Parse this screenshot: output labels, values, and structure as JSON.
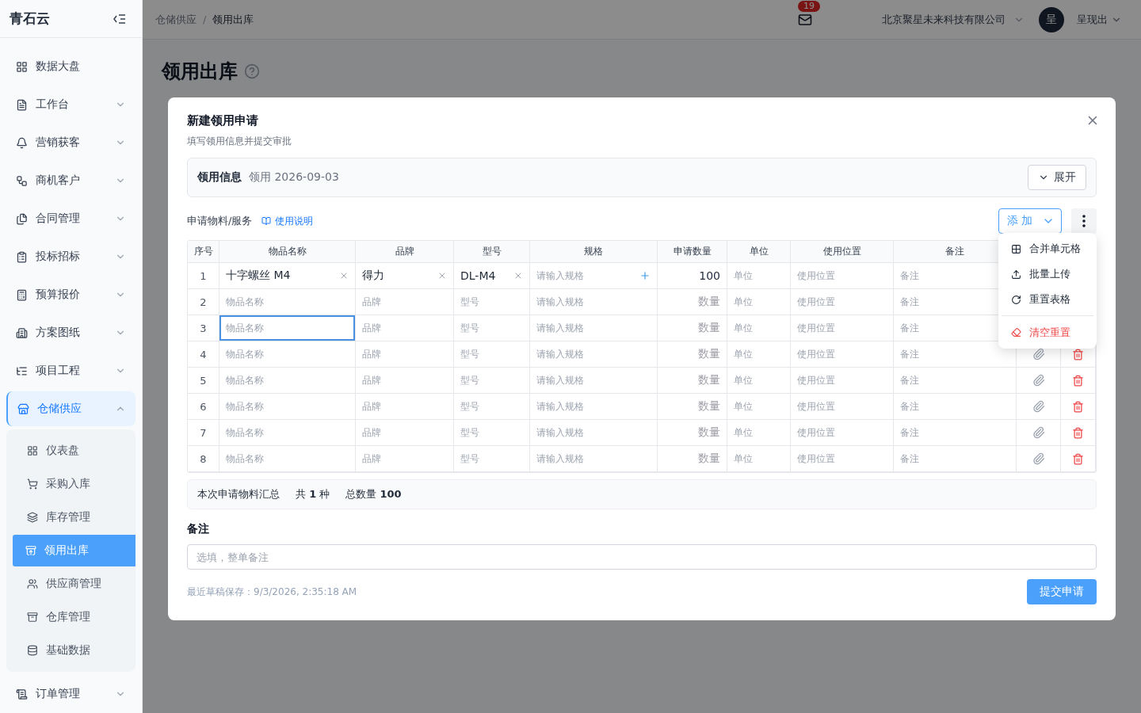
{
  "sidebar": {
    "logo": "青石云",
    "items": [
      {
        "label": "数据大盘",
        "kind": "link"
      },
      {
        "label": "工作台",
        "kind": "group",
        "expanded": false
      },
      {
        "label": "营销获客",
        "kind": "group",
        "expanded": false
      },
      {
        "label": "商机客户",
        "kind": "group",
        "expanded": false
      },
      {
        "label": "合同管理",
        "kind": "group",
        "expanded": false
      },
      {
        "label": "投标招标",
        "kind": "group",
        "expanded": false
      },
      {
        "label": "预算报价",
        "kind": "group",
        "expanded": false
      },
      {
        "label": "方案图纸",
        "kind": "group",
        "expanded": false
      },
      {
        "label": "项目工程",
        "kind": "group",
        "expanded": false
      },
      {
        "label": "仓储供应",
        "kind": "group",
        "expanded": true,
        "children": [
          {
            "label": "仪表盘",
            "selected": false
          },
          {
            "label": "采购入库",
            "selected": false
          },
          {
            "label": "库存管理",
            "selected": false
          },
          {
            "label": "领用出库",
            "selected": true
          },
          {
            "label": "供应商管理",
            "selected": false
          },
          {
            "label": "仓库管理",
            "selected": false
          },
          {
            "label": "基础数据",
            "selected": false
          }
        ]
      },
      {
        "label": "订单管理",
        "kind": "group",
        "expanded": false
      }
    ]
  },
  "header": {
    "breadcrumb": [
      "仓储供应",
      "领用出库"
    ],
    "separator": "/",
    "notifications": "19",
    "company": "北京聚星未来科技有限公司",
    "avatar": "呈",
    "user": "呈现出"
  },
  "page": {
    "title": "领用出库"
  },
  "dialog": {
    "title": "新建领用申请",
    "subtitle": "填写领用信息并提交审批",
    "info": {
      "label": "领用信息",
      "value": "领用 2026-09-03",
      "toggle": "展开"
    },
    "section": "申请物料/服务",
    "help_link": "使用说明",
    "add_button": "添 加",
    "menu": [
      {
        "label": "合并单元格",
        "kind": "normal"
      },
      {
        "label": "批量上传",
        "kind": "normal"
      },
      {
        "label": "重置表格",
        "kind": "normal"
      },
      {
        "label": "清空重置",
        "kind": "danger"
      }
    ],
    "columns": [
      "序号",
      "物品名称",
      "品牌",
      "型号",
      "规格",
      "申请数量",
      "单位",
      "使用位置",
      "备注"
    ],
    "rows": [
      {
        "editing": true,
        "focused": false,
        "cells": [
          {
            "text": "1"
          },
          {
            "text": "十字螺丝 M4",
            "filled": true
          },
          {
            "text": "得力",
            "filled": true
          },
          {
            "text": "DL-M4",
            "filled": true
          },
          {
            "text": "请输入规格",
            "filled": false
          },
          {
            "text": "100",
            "filled": true
          },
          {
            "text": "单位",
            "filled": false
          },
          {
            "text": "使用位置",
            "filled": false
          },
          {
            "text": "备注",
            "filled": false
          }
        ]
      },
      {
        "editing": false,
        "focused": false,
        "cells": [
          {
            "text": "2"
          },
          {
            "text": "物品名称",
            "filled": false
          },
          {
            "text": "品牌",
            "filled": false
          },
          {
            "text": "型号",
            "filled": false
          },
          {
            "text": "请输入规格",
            "filled": false
          },
          {
            "text": "数量",
            "filled": false
          },
          {
            "text": "单位",
            "filled": false
          },
          {
            "text": "使用位置",
            "filled": false
          },
          {
            "text": "备注",
            "filled": false
          }
        ]
      },
      {
        "editing": false,
        "focused": true,
        "cells": [
          {
            "text": "3"
          },
          {
            "text": "物品名称",
            "filled": false
          },
          {
            "text": "品牌",
            "filled": false
          },
          {
            "text": "型号",
            "filled": false
          },
          {
            "text": "请输入规格",
            "filled": false
          },
          {
            "text": "数量",
            "filled": false
          },
          {
            "text": "单位",
            "filled": false
          },
          {
            "text": "使用位置",
            "filled": false
          },
          {
            "text": "备注",
            "filled": false
          }
        ]
      },
      {
        "editing": false,
        "focused": false,
        "cells": [
          {
            "text": "4"
          },
          {
            "text": "物品名称",
            "filled": false
          },
          {
            "text": "品牌",
            "filled": false
          },
          {
            "text": "型号",
            "filled": false
          },
          {
            "text": "请输入规格",
            "filled": false
          },
          {
            "text": "数量",
            "filled": false
          },
          {
            "text": "单位",
            "filled": false
          },
          {
            "text": "使用位置",
            "filled": false
          },
          {
            "text": "备注",
            "filled": false
          }
        ]
      },
      {
        "editing": false,
        "focused": false,
        "cells": [
          {
            "text": "5"
          },
          {
            "text": "物品名称",
            "filled": false
          },
          {
            "text": "品牌",
            "filled": false
          },
          {
            "text": "型号",
            "filled": false
          },
          {
            "text": "请输入规格",
            "filled": false
          },
          {
            "text": "数量",
            "filled": false
          },
          {
            "text": "单位",
            "filled": false
          },
          {
            "text": "使用位置",
            "filled": false
          },
          {
            "text": "备注",
            "filled": false
          }
        ]
      },
      {
        "editing": false,
        "focused": false,
        "cells": [
          {
            "text": "6"
          },
          {
            "text": "物品名称",
            "filled": false
          },
          {
            "text": "品牌",
            "filled": false
          },
          {
            "text": "型号",
            "filled": false
          },
          {
            "text": "请输入规格",
            "filled": false
          },
          {
            "text": "数量",
            "filled": false
          },
          {
            "text": "单位",
            "filled": false
          },
          {
            "text": "使用位置",
            "filled": false
          },
          {
            "text": "备注",
            "filled": false
          }
        ]
      },
      {
        "editing": false,
        "focused": false,
        "cells": [
          {
            "text": "7"
          },
          {
            "text": "物品名称",
            "filled": false
          },
          {
            "text": "品牌",
            "filled": false
          },
          {
            "text": "型号",
            "filled": false
          },
          {
            "text": "请输入规格",
            "filled": false
          },
          {
            "text": "数量",
            "filled": false
          },
          {
            "text": "单位",
            "filled": false
          },
          {
            "text": "使用位置",
            "filled": false
          },
          {
            "text": "备注",
            "filled": false
          }
        ]
      },
      {
        "editing": false,
        "focused": false,
        "cells": [
          {
            "text": "8"
          },
          {
            "text": "物品名称",
            "filled": false
          },
          {
            "text": "品牌",
            "filled": false
          },
          {
            "text": "型号",
            "filled": false
          },
          {
            "text": "请输入规格",
            "filled": false
          },
          {
            "text": "数量",
            "filled": false
          },
          {
            "text": "单位",
            "filled": false
          },
          {
            "text": "使用位置",
            "filled": false
          },
          {
            "text": "备注",
            "filled": false
          }
        ]
      }
    ],
    "summary": {
      "label": "本次申请物料汇总",
      "kinds": "共 **1** 种",
      "total": "总数量 **100**"
    },
    "remark_label": "备注",
    "remark_placeholder": "选填，整单备注",
    "draft": "最近草稿保存：9/3/2026, 2:35:18 AM",
    "submit": "提交申请"
  }
}
